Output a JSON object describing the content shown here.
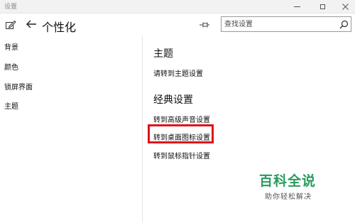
{
  "window": {
    "title": "设置",
    "controls": [
      "minimize-icon",
      "maximize-icon",
      "close-icon"
    ]
  },
  "header": {
    "page_title": "个性化",
    "search_placeholder": "查找设置",
    "icons": [
      "edit-icon",
      "back-arrow-icon",
      "pin-icon",
      "search-icon"
    ]
  },
  "sidebar": {
    "items": [
      {
        "label": "背景"
      },
      {
        "label": "颜色"
      },
      {
        "label": "锁屏界面"
      },
      {
        "label": "主题"
      }
    ]
  },
  "main": {
    "section1": {
      "heading": "主题",
      "links": [
        {
          "label": "请转到主题设置"
        }
      ]
    },
    "section2": {
      "heading": "经典设置",
      "links": [
        {
          "label": "转到高级声音设置"
        },
        {
          "label": "转到桌面图标设置"
        },
        {
          "label": "转到鼠标指针设置"
        }
      ]
    }
  },
  "annotation": {
    "highlighted_item": "转到桌面图标设置",
    "highlight_color": "#e0121b"
  },
  "watermark": {
    "main": "百科全说",
    "sub": "助你轻松解决",
    "color": "#2a9b5e"
  }
}
